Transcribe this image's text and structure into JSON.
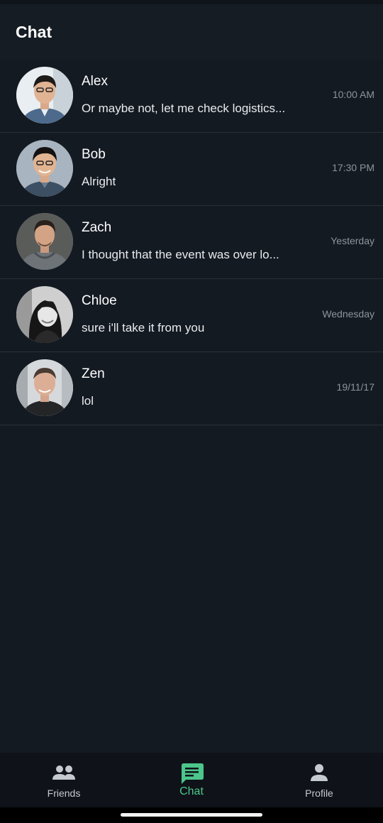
{
  "header": {
    "title": "Chat"
  },
  "chats": [
    {
      "name": "Alex",
      "message": "Or maybe not, let me check logistics...",
      "time": "10:00 AM"
    },
    {
      "name": "Bob",
      "message": "Alright",
      "time": "17:30 PM"
    },
    {
      "name": "Zach",
      "message": "I thought that the event was over lo...",
      "time": "Yesterday"
    },
    {
      "name": "Chloe",
      "message": "sure i'll take it from you",
      "time": "Wednesday"
    },
    {
      "name": "Zen",
      "message": "lol",
      "time": "19/11/17"
    }
  ],
  "nav": {
    "items": [
      {
        "label": "Friends",
        "icon": "people-icon"
      },
      {
        "label": "Chat",
        "icon": "chat-bubble-icon",
        "active": true
      },
      {
        "label": "Profile",
        "icon": "person-icon"
      }
    ]
  },
  "colors": {
    "background": "#141a22",
    "accent": "#4cc68b",
    "nav_background": "#0f1319",
    "divider": "#27303a"
  }
}
